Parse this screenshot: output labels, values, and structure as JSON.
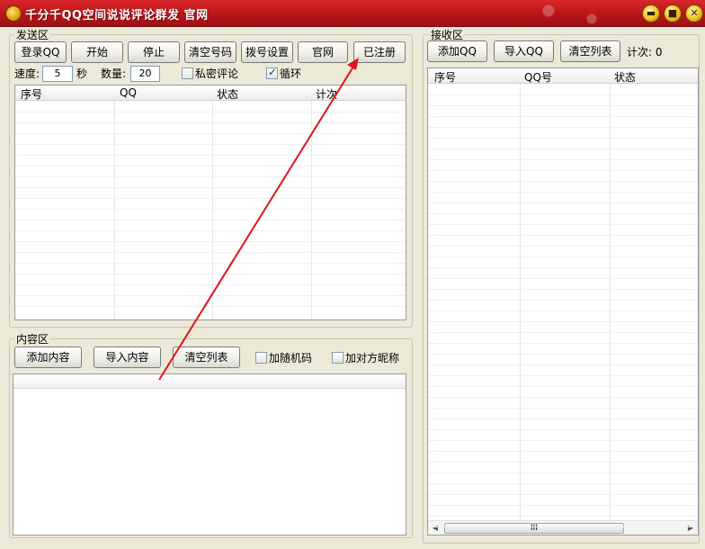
{
  "window": {
    "title": "千分千QQ空间说说评论群发 官网",
    "controls": {
      "minimize": "▬",
      "maximize": "■",
      "close": "✕"
    }
  },
  "send_area": {
    "label": "发送区",
    "buttons": {
      "login": "登录QQ",
      "start": "开始",
      "stop": "停止",
      "clear_numbers": "清空号码",
      "dial_settings": "拨号设置",
      "website": "官网",
      "registered": "已注册"
    },
    "speed_label": "速度:",
    "speed_value": "5",
    "speed_unit": "秒",
    "count_label": "数量:",
    "count_value": "20",
    "private_comment": {
      "label": "私密评论",
      "checked": false
    },
    "loop": {
      "label": "循环",
      "checked": true
    },
    "columns": [
      "序号",
      "QQ",
      "状态",
      "计次"
    ]
  },
  "content_area": {
    "label": "内容区",
    "buttons": {
      "add_content": "添加内容",
      "import_content": "导入内容",
      "clear_list": "清空列表"
    },
    "random_code": {
      "label": "加随机码",
      "checked": false
    },
    "nickname": {
      "label": "加对方昵称",
      "checked": false
    }
  },
  "receive_area": {
    "label": "接收区",
    "buttons": {
      "add_qq": "添加QQ",
      "import_qq": "导入QQ",
      "clear_list": "清空列表"
    },
    "count_label": "计次: 0",
    "columns": [
      "序号",
      "QQ号",
      "状态"
    ],
    "scroll_grip": "III"
  },
  "annotation": {
    "color": "#e0141c"
  }
}
